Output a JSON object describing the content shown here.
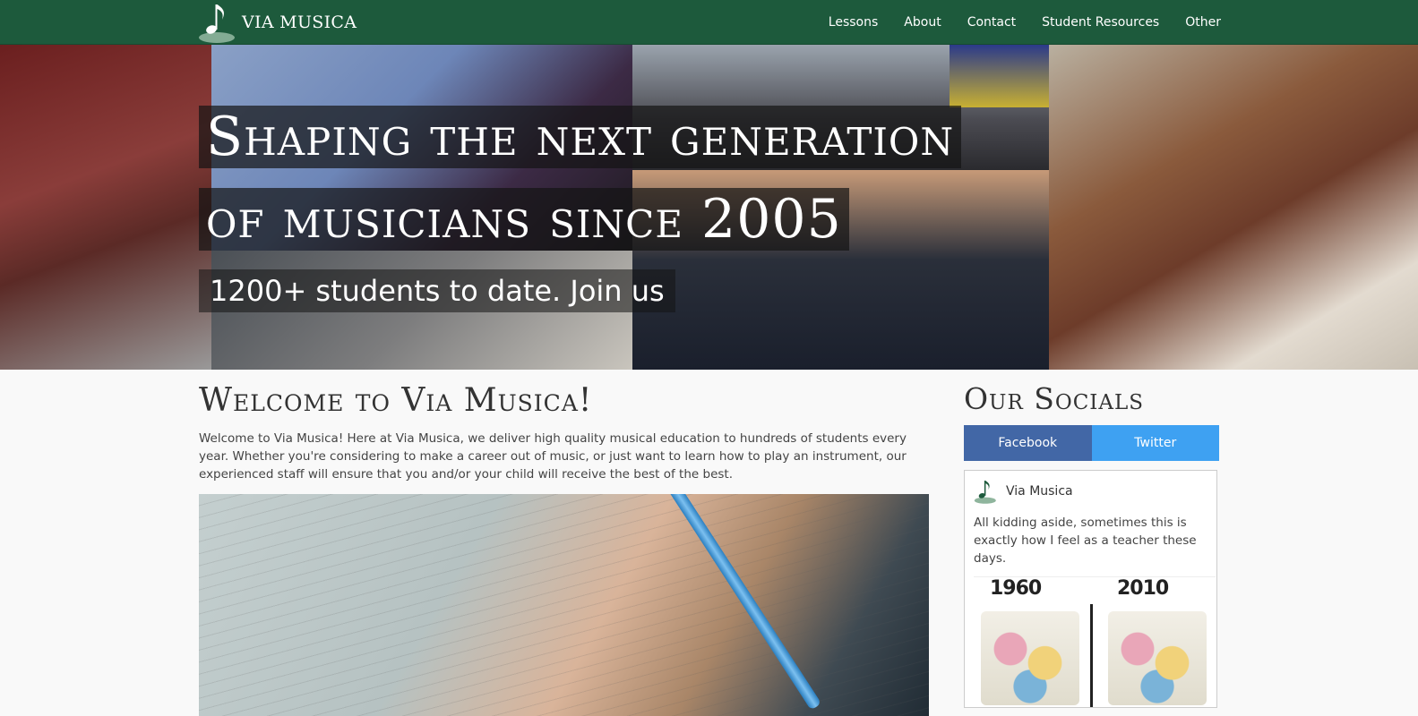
{
  "navbar": {
    "brand_name": "VIA MUSICA",
    "links": [
      "Lessons",
      "About",
      "Contact",
      "Student Resources",
      "Other"
    ],
    "color": "#1d5a3c"
  },
  "hero": {
    "line1": "Shaping the next generation",
    "line2": "of musicians since 2005",
    "line3": "1200+ students to date. Join us"
  },
  "main": {
    "title": "Welcome to Via Musica!",
    "text": "Welcome to Via Musica! Here at Via Musica, we deliver high quality musical education to hundreds of students every year. Whether you're considering to make a career out of music, or just want to learn how to play an instrument, our experienced staff will ensure that you and/or your child will receive the best of the best."
  },
  "sidebar": {
    "title": "Our Socials",
    "tabs": [
      "Facebook",
      "Twitter"
    ],
    "post": {
      "name": "Via Musica",
      "text": "All kidding aside, sometimes this is exactly how I feel as a teacher these days.",
      "comic_years": [
        "1960",
        "2010"
      ]
    },
    "colors": {
      "facebook": "#4267a6",
      "twitter": "#3ea1f2"
    }
  },
  "icons": {
    "brand_logo": "music-note-icon",
    "post_avatar": "music-note-icon"
  }
}
